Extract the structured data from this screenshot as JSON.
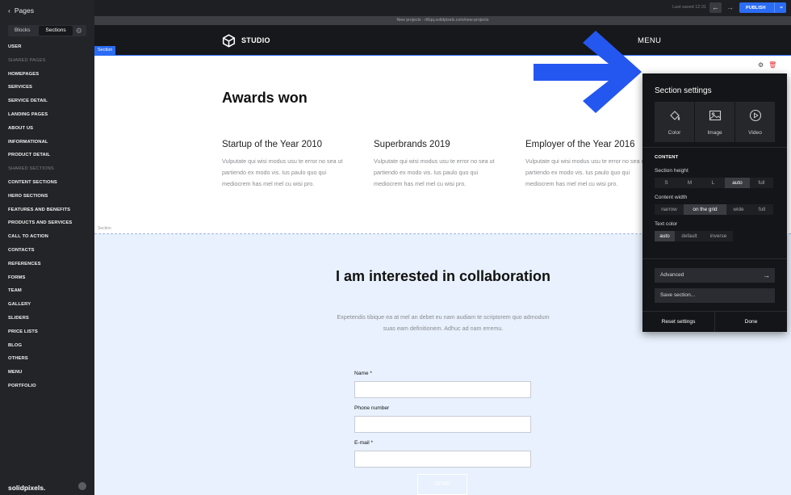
{
  "sidebar": {
    "back_label": "Pages",
    "tabs": [
      "Blocks",
      "Sections"
    ],
    "active_tab": "Sections",
    "items": [
      {
        "label": "USER",
        "heading": false
      },
      {
        "label": "SHARED PAGES",
        "heading": true
      },
      {
        "label": "HOMEPAGES",
        "heading": false
      },
      {
        "label": "SERVICES",
        "heading": false
      },
      {
        "label": "SERVICE DETAIL",
        "heading": false
      },
      {
        "label": "LANDING PAGES",
        "heading": false
      },
      {
        "label": "ABOUT US",
        "heading": false
      },
      {
        "label": "INFORMATIONAL",
        "heading": false
      },
      {
        "label": "PRODUCT DETAIL",
        "heading": false
      },
      {
        "label": "SHARED SECTIONS",
        "heading": true
      },
      {
        "label": "CONTENT SECTIONS",
        "heading": false
      },
      {
        "label": "HERO SECTIONS",
        "heading": false
      },
      {
        "label": "FEATURES AND BENEFITS",
        "heading": false
      },
      {
        "label": "PRODUCTS AND SERVICES",
        "heading": false
      },
      {
        "label": "CALL TO ACTION",
        "heading": false
      },
      {
        "label": "CONTACTS",
        "heading": false
      },
      {
        "label": "REFERENCES",
        "heading": false
      },
      {
        "label": "FORMS",
        "heading": false
      },
      {
        "label": "TEAM",
        "heading": false
      },
      {
        "label": "GALLERY",
        "heading": false
      },
      {
        "label": "SLIDERS",
        "heading": false
      },
      {
        "label": "PRICE LISTS",
        "heading": false
      },
      {
        "label": "BLOG",
        "heading": false
      },
      {
        "label": "OTHERS",
        "heading": false
      },
      {
        "label": "MENU",
        "heading": false
      },
      {
        "label": "PORTFOLIO",
        "heading": false
      }
    ],
    "brand": "solidpixels."
  },
  "topbar": {
    "saved_text": "Last saved 12:31",
    "publish_label": "PUBLISH"
  },
  "url_text": "New projects - rt6qq.solidpixels.com/new-projects",
  "site_header": {
    "logo_text": "STUDIO",
    "menu_label": "MENU"
  },
  "section_tag": "Section",
  "awards": {
    "title": "Awards won",
    "items": [
      {
        "title": "Startup of the Year 2010",
        "text": "Vulputate qui wisi modus usu te error no sea ut partiendo ex modo vis. Ius paulo quo qui mediocrem has mel mel cu wisi pro."
      },
      {
        "title": "Superbrands 2019",
        "text": "Vulputate qui wisi modus usu te error no sea ut partiendo ex modo vis. Ius paulo quo qui mediocrem has mel mel cu wisi pro."
      },
      {
        "title": "Employer of the Year 2016",
        "text": "Vulputate qui wisi modus usu te error no sea ut partiendo ex modo vis. Ius paulo quo qui mediocrem has mel mel cu wisi pro."
      }
    ]
  },
  "collab": {
    "title": "I am interested in collaboration",
    "description": "Expetendis tibique ea at mel an debet eu nam audiam te scriptorem quo admodum suas eam definitionem. Adhuc ad nam erremu.",
    "fields": [
      {
        "label": "Name *",
        "value": ""
      },
      {
        "label": "Phone number",
        "value": ""
      },
      {
        "label": "E-mail *",
        "value": ""
      }
    ],
    "send_label": "SEND"
  },
  "settings": {
    "title": "Section settings",
    "bg_options": [
      {
        "label": "Color",
        "icon": "paint-bucket-icon"
      },
      {
        "label": "Image",
        "icon": "image-icon"
      },
      {
        "label": "Video",
        "icon": "play-icon"
      }
    ],
    "content_heading": "CONTENT",
    "height": {
      "label": "Section height",
      "options": [
        "S",
        "M",
        "L",
        "auto",
        "full"
      ],
      "selected": "auto"
    },
    "width": {
      "label": "Content width",
      "options": [
        "narrow",
        "on the grid",
        "wide",
        "full"
      ],
      "selected": "on the grid"
    },
    "text_color": {
      "label": "Text color",
      "options": [
        "auto",
        "default",
        "inverse"
      ],
      "selected": "auto"
    },
    "advanced_label": "Advanced",
    "save_label": "Save section...",
    "reset_label": "Reset settings",
    "done_label": "Done"
  },
  "colors": {
    "accent": "#2b6cf5",
    "arrow": "#2456f0",
    "collab_bg": "#e8f1fd",
    "panel_bg": "#141518"
  }
}
